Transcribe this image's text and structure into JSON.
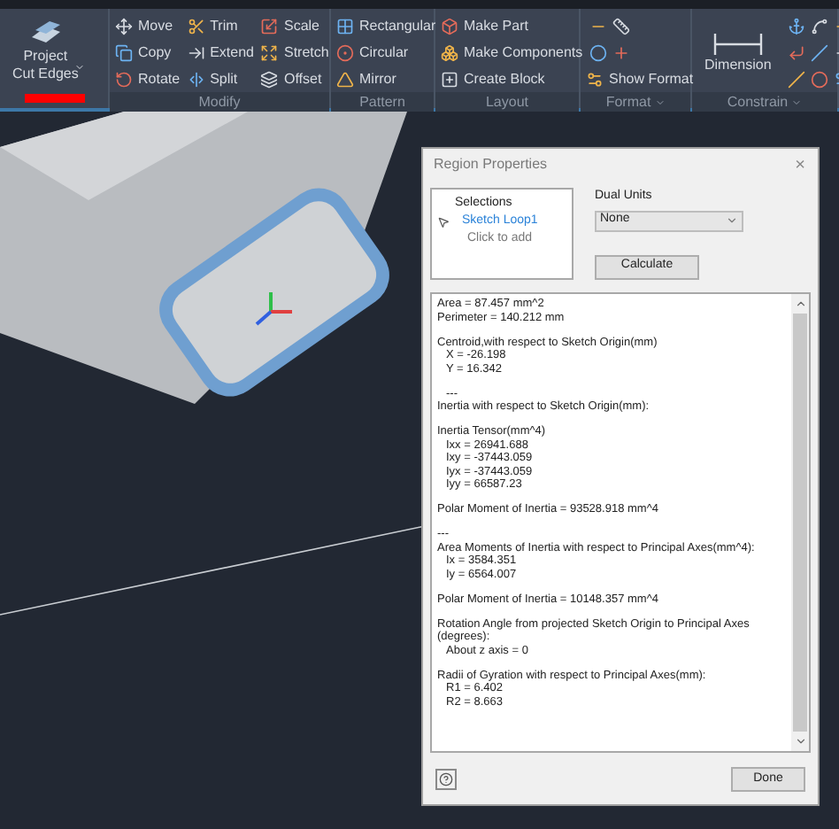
{
  "ribbon": {
    "panels": [
      {
        "tools": [
          {
            "kind": "large",
            "label": "Project\nCut Edges",
            "dropdown": true,
            "highlight": true
          }
        ]
      },
      {
        "title": "Modify",
        "tools": [
          {
            "kind": "small",
            "label": "Move"
          },
          {
            "kind": "small",
            "label": "Copy"
          },
          {
            "kind": "small",
            "label": "Rotate"
          },
          {
            "kind": "small",
            "label": "Trim"
          },
          {
            "kind": "small",
            "label": "Extend"
          },
          {
            "kind": "small",
            "label": "Split"
          },
          {
            "kind": "small",
            "label": "Scale"
          },
          {
            "kind": "small",
            "label": "Stretch"
          },
          {
            "kind": "small",
            "label": "Offset"
          }
        ]
      },
      {
        "title": "Pattern",
        "tools": [
          {
            "kind": "small",
            "label": "Rectangular"
          },
          {
            "kind": "small",
            "label": "Circular"
          },
          {
            "kind": "small",
            "label": "Mirror"
          }
        ]
      },
      {
        "title": "Layout",
        "tools": [
          {
            "kind": "small",
            "label": "Make Part"
          },
          {
            "kind": "small",
            "label": "Make Components"
          },
          {
            "kind": "small",
            "label": "Create Block"
          }
        ]
      },
      {
        "title": "Format",
        "dropdown": true,
        "tools": [
          {
            "kind": "icon"
          },
          {
            "kind": "icon"
          },
          {
            "kind": "icon"
          },
          {
            "kind": "icon"
          },
          {
            "kind": "small",
            "label": "Show Format"
          }
        ]
      },
      {
        "title": "Constrain",
        "dropdown": true,
        "tools": [
          {
            "kind": "large",
            "label": "Dimension"
          },
          {
            "kind": "icon"
          },
          {
            "kind": "icon"
          },
          {
            "kind": "icon"
          },
          {
            "kind": "icon"
          },
          {
            "kind": "icon"
          },
          {
            "kind": "icon"
          },
          {
            "kind": "icon"
          },
          {
            "kind": "icon"
          },
          {
            "kind": "icon"
          }
        ]
      }
    ]
  },
  "dialog": {
    "title": "Region Properties",
    "close": "×",
    "selections": {
      "header": "Selections",
      "items": [
        {
          "label": "Sketch Loop1",
          "selected": true
        },
        {
          "label": "Click to add",
          "selected": false
        }
      ]
    },
    "dual_units": {
      "label": "Dual Units",
      "value": "None"
    },
    "calculate": "Calculate",
    "results": [
      [
        {
          "text": "Area = 87.457 mm^2",
          "indent": false
        },
        {
          "text": "Perimeter = 140.212 mm",
          "indent": false
        }
      ],
      [
        {
          "text": "Centroid,with respect to Sketch Origin(mm)",
          "indent": false
        },
        {
          "text": "X = -26.198",
          "indent": true
        },
        {
          "text": "Y = 16.342",
          "indent": true
        }
      ],
      [
        {
          "text": "---",
          "indent": true
        },
        {
          "text": "Inertia with respect to Sketch Origin(mm):",
          "indent": false
        }
      ],
      [
        {
          "text": "Inertia Tensor(mm^4)",
          "indent": false
        },
        {
          "text": "Ixx = 26941.688",
          "indent": true
        },
        {
          "text": "Ixy = -37443.059",
          "indent": true
        },
        {
          "text": "Iyx = -37443.059",
          "indent": true
        },
        {
          "text": "Iyy = 66587.23",
          "indent": true
        }
      ],
      [
        {
          "text": "Polar Moment of Inertia = 93528.918 mm^4",
          "indent": false
        }
      ],
      [
        {
          "text": "---",
          "indent": false
        },
        {
          "text": "Area Moments of Inertia with respect to Principal Axes(mm^4):",
          "indent": false
        },
        {
          "text": "Ix = 3584.351",
          "indent": true
        },
        {
          "text": "Iy = 6564.007",
          "indent": true
        }
      ],
      [
        {
          "text": "Polar Moment of Inertia = 10148.357 mm^4",
          "indent": false
        }
      ],
      [
        {
          "text": "Rotation Angle from projected Sketch Origin to Principal Axes",
          "indent": false
        },
        {
          "text": "(degrees):",
          "indent": false
        },
        {
          "text": "About z axis = 0",
          "indent": true
        }
      ],
      [
        {
          "text": "Radii of Gyration with respect to Principal Axes(mm):",
          "indent": false
        },
        {
          "text": "R1 = 6.402",
          "indent": true
        },
        {
          "text": "R2 = 8.663",
          "indent": true
        }
      ]
    ],
    "done": "Done"
  }
}
